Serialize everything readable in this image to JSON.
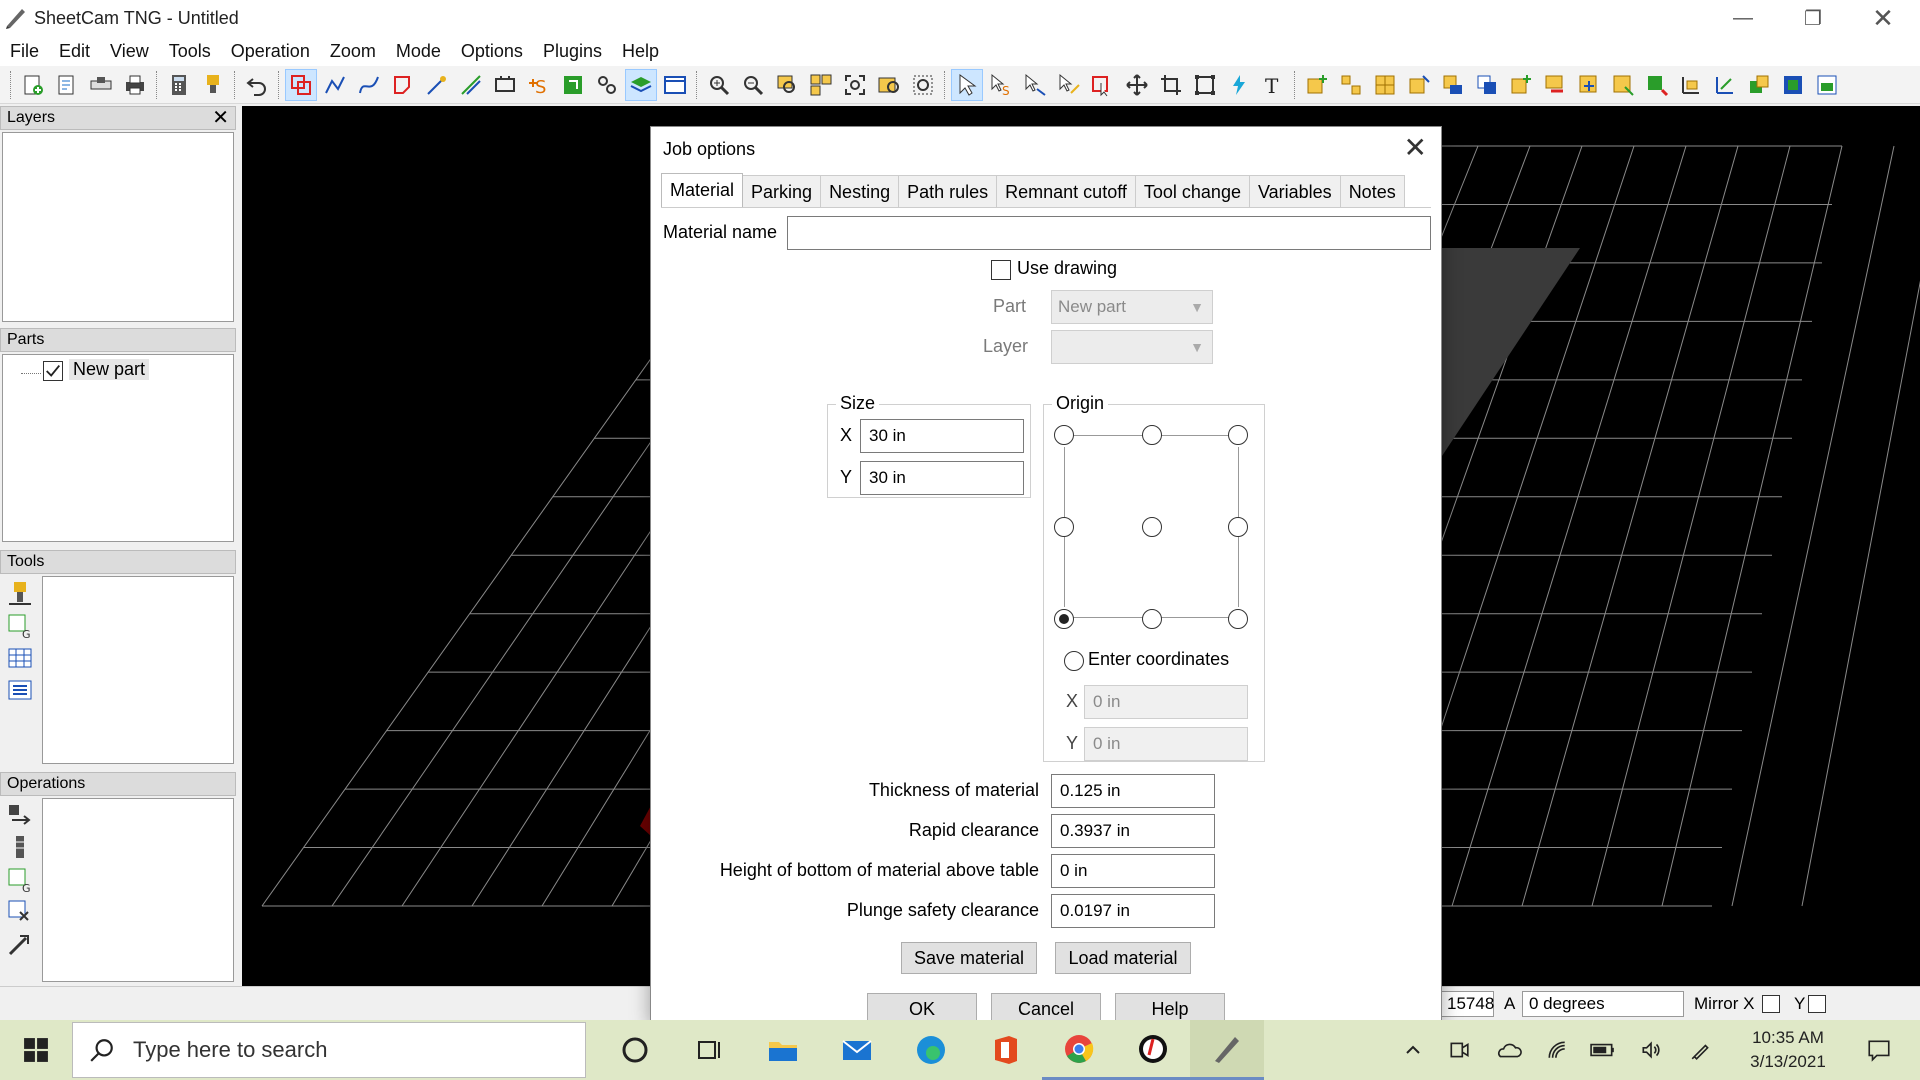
{
  "app": {
    "title": "SheetCam TNG - Untitled"
  },
  "menu": [
    "File",
    "Edit",
    "View",
    "Tools",
    "Operation",
    "Zoom",
    "Mode",
    "Options",
    "Plugins",
    "Help"
  ],
  "panels": {
    "layers": {
      "title": "Layers"
    },
    "parts": {
      "title": "Parts",
      "items": [
        {
          "label": "New part",
          "checked": true
        }
      ]
    },
    "tools": {
      "title": "Tools"
    },
    "operations": {
      "title": "Operations"
    }
  },
  "dialog": {
    "title": "Job options",
    "tabs": [
      "Material",
      "Parking",
      "Nesting",
      "Path rules",
      "Remnant cutoff",
      "Tool change",
      "Variables",
      "Notes"
    ],
    "active_tab": "Material",
    "material_name_label": "Material name",
    "material_name_value": "",
    "use_drawing_label": "Use drawing",
    "use_drawing_checked": false,
    "part_label": "Part",
    "part_value": "New part",
    "layer_label": "Layer",
    "layer_value": "",
    "size": {
      "title": "Size",
      "x_label": "X",
      "x_value": "30 in",
      "y_label": "Y",
      "y_value": "30 in"
    },
    "origin": {
      "title": "Origin",
      "selected": "bottom-left",
      "enter_coordinates_label": "Enter coordinates",
      "x_label": "X",
      "x_value": "0 in",
      "y_label": "Y",
      "y_value": "0 in"
    },
    "thickness_label": "Thickness of material",
    "thickness_value": "0.125 in",
    "rapid_label": "Rapid clearance",
    "rapid_value": "0.3937 in",
    "height_label": "Height of bottom of material above table",
    "height_value": "0 in",
    "plunge_label": "Plunge safety clearance",
    "plunge_value": "0.0197 in",
    "save_material": "Save material",
    "load_material": "Load material",
    "ok": "OK",
    "cancel": "Cancel",
    "help": "Help"
  },
  "statusbar": {
    "coord_partial": "15748",
    "angle_label": "A",
    "angle_value": "0 degrees",
    "mirror_label": "Mirror X",
    "mirror_y_label": "Y"
  },
  "taskbar": {
    "search_placeholder": "Type here to search",
    "time": "10:35 AM",
    "date": "3/13/2021"
  },
  "colors": {
    "canvas": "#000000",
    "grid": "#8a8a8a",
    "part_fill": "#6b0000",
    "taskbar": "#dfe8c7"
  }
}
